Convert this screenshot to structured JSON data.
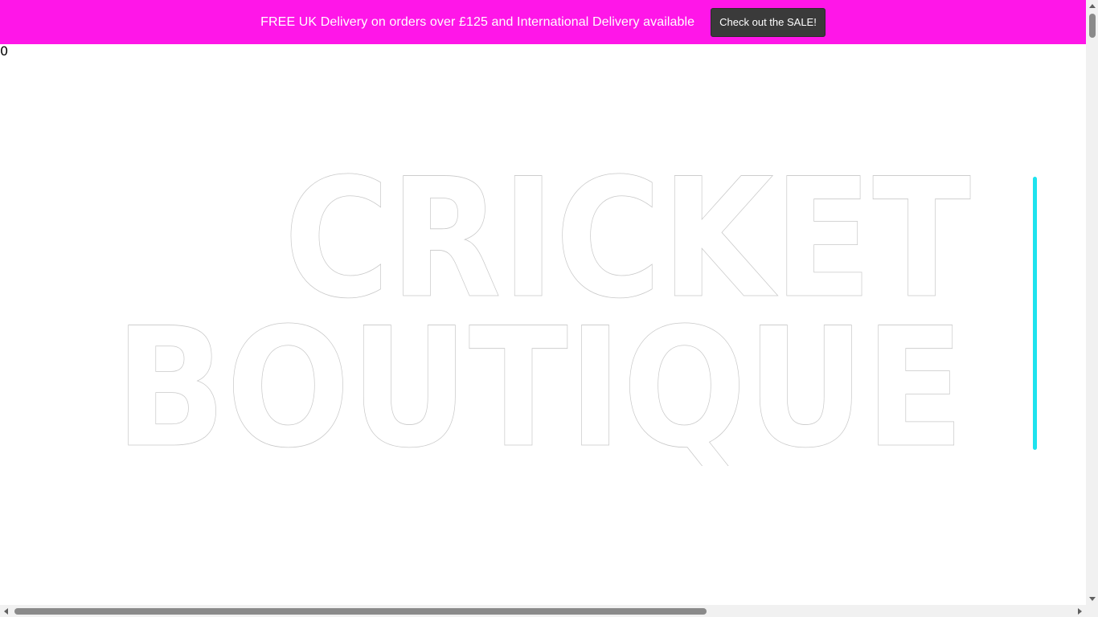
{
  "announcement": {
    "text": "FREE UK Delivery on orders over £125 and International Delivery available",
    "button_label": "Check out the SALE!",
    "background_color": "#ff16e8"
  },
  "counter": {
    "value": "0"
  },
  "logo": {
    "line1": "CRICKET",
    "line2": "BOUTIQUE",
    "accent_color": "#1ee3ee"
  },
  "scrollbars": {
    "vertical": {
      "up_icon": "arrow-up-icon",
      "down_icon": "arrow-down-icon"
    },
    "horizontal": {
      "left_icon": "arrow-left-icon",
      "right_icon": "arrow-right-icon"
    }
  }
}
